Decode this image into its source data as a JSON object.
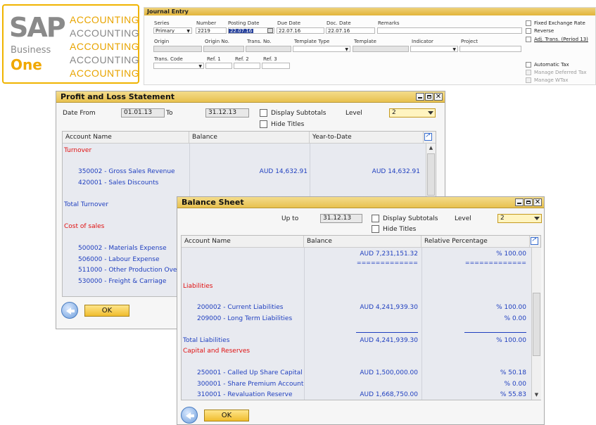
{
  "logo": {
    "brand": "SAP",
    "product_line1": "Business",
    "product_line2": "One",
    "accounting_lines": [
      "ACCOUNTING",
      "ACCOUNTING",
      "ACCOUNTING",
      "ACCOUNTING",
      "ACCOUNTING"
    ],
    "colors": {
      "border": "#f0b400",
      "gold": "#e8a400",
      "grey": "#888888"
    }
  },
  "journal_entry": {
    "title": "Journal Entry",
    "labels": {
      "series": "Series",
      "number": "Number",
      "posting_date": "Posting Date",
      "due_date": "Due Date",
      "doc_date": "Doc. Date",
      "remarks": "Remarks",
      "origin": "Origin",
      "origin_no": "Origin No.",
      "trans_no": "Trans. No.",
      "template_type": "Template Type",
      "template": "Template",
      "indicator": "Indicator",
      "project": "Project",
      "trans_code": "Trans. Code",
      "ref1": "Ref. 1",
      "ref2": "Ref. 2",
      "ref3": "Ref. 3"
    },
    "values": {
      "series": "Primary",
      "number": "2219",
      "posting_date": "22.07.16",
      "due_date": "22.07.16",
      "doc_date": "22.07.16"
    },
    "checkboxes": {
      "fixed_exchange_rate": "Fixed Exchange Rate",
      "reverse": "Reverse",
      "adj_trans": "Adj. Trans. (Period 13)",
      "automatic_tax": "Automatic Tax",
      "manage_deferred_tax": "Manage Deferred Tax",
      "manage_wtax": "Manage WTax"
    }
  },
  "profit_loss": {
    "title": "Profit and Loss Statement",
    "date_from_label": "Date From",
    "date_from": "01.01.13",
    "to_label": "To",
    "to": "31.12.13",
    "display_subtotals": "Display Subtotals",
    "hide_titles": "Hide Titles",
    "level_label": "Level",
    "level": "2",
    "columns": [
      "Account Name",
      "Balance",
      "Year-to-Date"
    ],
    "rows": {
      "turnover": "Turnover",
      "gross_sales": "350002 - Gross Sales Revenue",
      "gross_sales_balance": "AUD  14,632.91",
      "gross_sales_ytd": "AUD  14,632.91",
      "sales_discounts": "420001 - Sales Discounts",
      "total_turnover": "Total Turnover",
      "cost_of_sales": "Cost of sales",
      "materials": "500002 - Materials Expense",
      "labour": "506000 - Labour Expense",
      "other_production": "511000 - Other Production Ove",
      "freight": "530000 - Freight & Carriage"
    },
    "ok_label": "OK"
  },
  "balance_sheet": {
    "title": "Balance Sheet",
    "up_to_label": "Up to",
    "up_to": "31.12.13",
    "display_subtotals": "Display Subtotals",
    "hide_titles": "Hide Titles",
    "level_label": "Level",
    "level": "2",
    "columns": [
      "Account Name",
      "Balance",
      "Relative Percentage"
    ],
    "rows": {
      "top_balance": "AUD  7,231,151.32",
      "top_pct": "% 100.00",
      "eq_line": "=============",
      "liabilities": "Liabilities",
      "current_liab": "200002 - Current Liabilities",
      "current_liab_balance": "AUD  4,241,939.30",
      "current_liab_pct": "% 100.00",
      "long_term_liab": "209000 - Long Term Liabilities",
      "long_term_liab_pct": "% 0.00",
      "total_liab": "Total Liabilities",
      "total_liab_balance": "AUD  4,241,939.30",
      "total_liab_pct": "% 100.00",
      "capital": "Capital and Reserves",
      "share_capital": "250001 - Called Up Share Capital",
      "share_capital_balance": "AUD  1,500,000.00",
      "share_capital_pct": "% 50.18",
      "share_premium": "300001 - Share Premium Account",
      "share_premium_pct": "% 0.00",
      "revaluation": "310001 - Revaluation Reserve",
      "revaluation_balance": "AUD  1,668,750.00",
      "revaluation_pct": "% 55.83"
    },
    "ok_label": "OK"
  }
}
